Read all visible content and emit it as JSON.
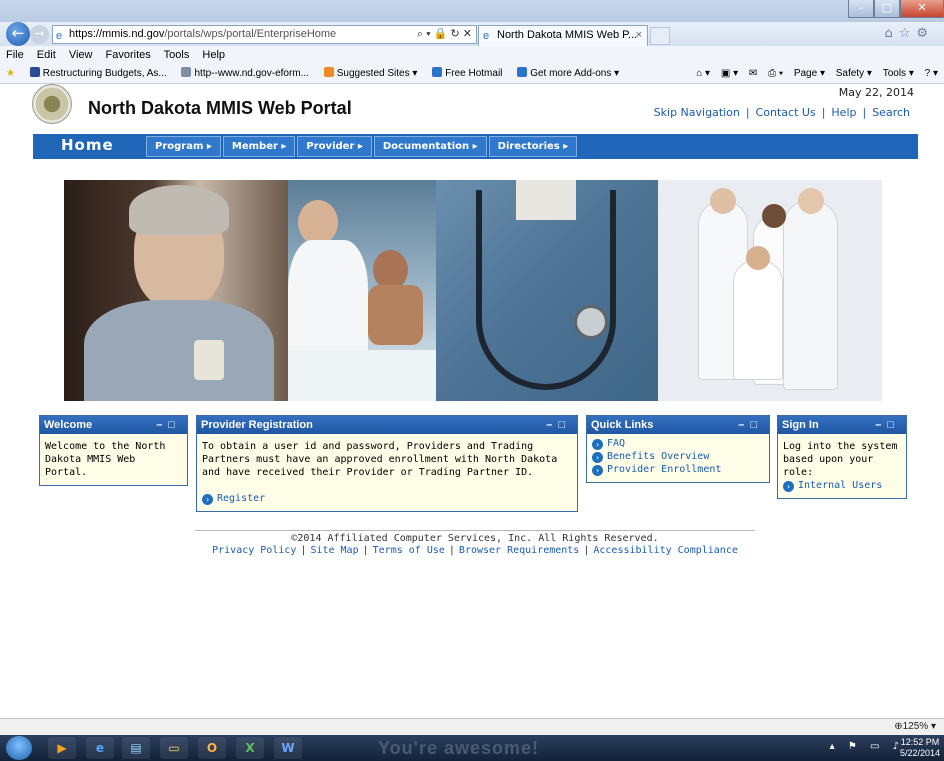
{
  "browser": {
    "address_host": "https://mmis.nd.gov",
    "address_path": "/portals/wps/portal/EnterpriseHome",
    "tab_title": "North Dakota MMIS Web P...",
    "menu": [
      "File",
      "Edit",
      "View",
      "Favorites",
      "Tools",
      "Help"
    ],
    "favorites": [
      {
        "label": "Restructuring Budgets, As...",
        "color": "#2a4a9a"
      },
      {
        "label": "http--www.nd.gov-eform...",
        "color": "#7f8fa6"
      },
      {
        "label": "Suggested Sites ▾",
        "color": "#f08a24"
      },
      {
        "label": "Free Hotmail",
        "color": "#2a74c9"
      },
      {
        "label": "Get more Add-ons ▾",
        "color": "#2a74c9"
      }
    ],
    "commands": [
      "Page ▾",
      "Safety ▾",
      "Tools ▾"
    ],
    "zoom": "125%"
  },
  "header": {
    "site_title": "North Dakota MMIS Web Portal",
    "date": "May 22, 2014",
    "links": [
      "Skip Navigation",
      "Contact Us",
      "Help",
      "Search"
    ]
  },
  "nav": {
    "home": "Home",
    "items": [
      "Program ▸",
      "Member ▸",
      "Provider ▸",
      "Documentation ▸",
      "Directories ▸"
    ]
  },
  "portlets": {
    "welcome": {
      "title": "Welcome",
      "body": "Welcome to the North Dakota MMIS Web Portal."
    },
    "provider_registration": {
      "title": "Provider Registration",
      "body": "To obtain a user id and password, Providers and Trading Partners must have an approved enrollment with North Dakota and have received their Provider or Trading Partner ID.",
      "link": "Register"
    },
    "quick_links": {
      "title": "Quick Links",
      "links": [
        "FAQ",
        "Benefits Overview",
        "Provider Enrollment"
      ]
    },
    "sign_in": {
      "title": "Sign In",
      "body": "Log into the system based upon your role:",
      "link": "Internal Users"
    }
  },
  "footer": {
    "copyright": "©2014 Affiliated Computer Services, Inc. All Rights Reserved.",
    "links": [
      "Privacy Policy",
      "Site Map",
      "Terms of Use",
      "Browser Requirements",
      "Accessibility Compliance"
    ]
  },
  "taskbar": {
    "wallpaper_text": "You're awesome!",
    "time": "12:52 PM",
    "date": "5/22/2014"
  },
  "colors": {
    "nav_blue": "#2066b8",
    "portlet_header": "#1f57a3",
    "portlet_body": "#fefde8",
    "link": "#1a5cb0"
  }
}
